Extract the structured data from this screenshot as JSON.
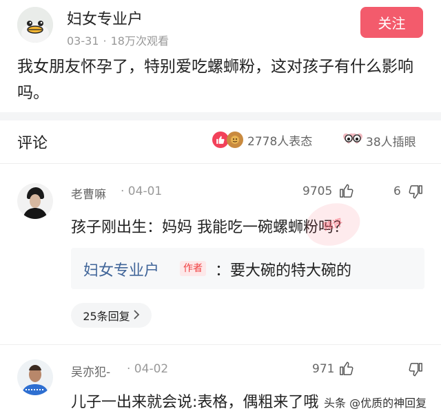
{
  "post": {
    "author": "妇女专业户",
    "date": "03-31",
    "separator": "·",
    "views": "18万次观看",
    "follow_label": "关注",
    "text": "我女朋友怀孕了，特别爱吃螺蛳粉，这对孩子有什么影响吗。"
  },
  "comments_bar": {
    "heading": "评论",
    "reactions_count": "2778人表态",
    "collect_count": "38人插眼"
  },
  "comments": [
    {
      "author": "老曹嘛",
      "date": "· 04-01",
      "likes": "9705",
      "dislikes": "6",
      "text": "孩子刚出生：妈妈 我能吃一碗螺蛳粉吗？",
      "author_reply": {
        "name": "妇女专业户",
        "tag": "作者",
        "text": "：要大碗的特大碗的"
      },
      "replies_label": "25条回复"
    },
    {
      "author": "吴亦犯-",
      "date": "· 04-02",
      "likes": "971",
      "dislikes": "",
      "text": "儿子一出来就会说:表格，偶粗来了哦"
    }
  ],
  "stamp_text": "辣评",
  "watermark": "头条 @优质的神回复",
  "colors": {
    "follow_button": "#f35b6c",
    "reply_name": "#406599",
    "author_tag_text": "#f04142",
    "like_reaction": "#f2415a"
  }
}
